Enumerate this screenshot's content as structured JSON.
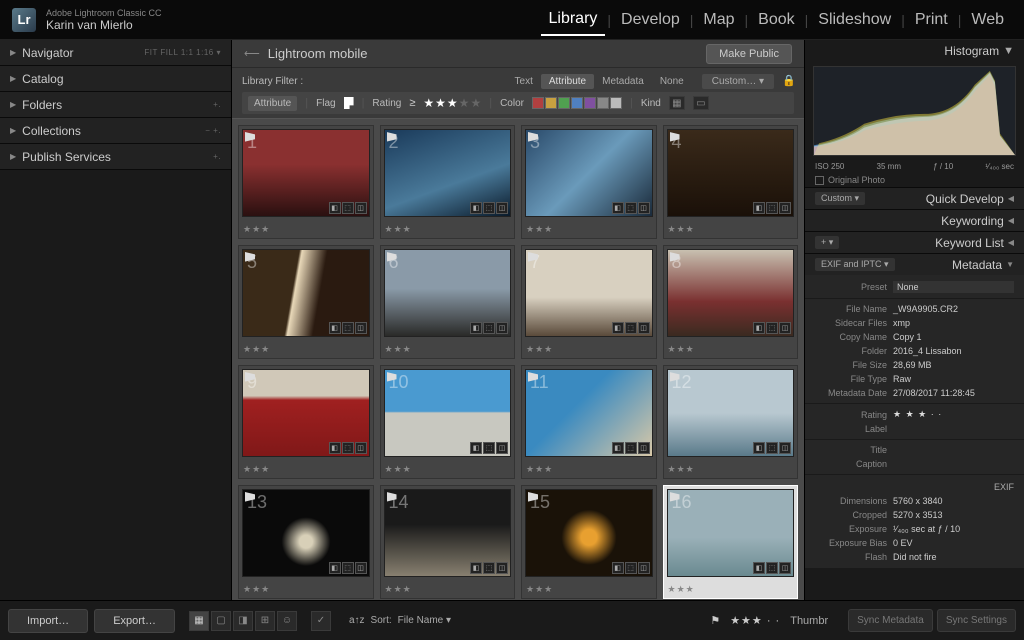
{
  "app": {
    "title": "Adobe Lightroom Classic CC",
    "user": "Karin van Mierlo",
    "logo": "Lr"
  },
  "modules": [
    "Library",
    "Develop",
    "Map",
    "Book",
    "Slideshow",
    "Print",
    "Web"
  ],
  "active_module": "Library",
  "left_panels": [
    {
      "title": "Navigator",
      "right": "FIT  FILL  1:1  1:16 ▾"
    },
    {
      "title": "Catalog",
      "right": ""
    },
    {
      "title": "Folders",
      "right": "+."
    },
    {
      "title": "Collections",
      "right": "−  +."
    },
    {
      "title": "Publish Services",
      "right": "+."
    }
  ],
  "center": {
    "collection_title": "Lightroom mobile",
    "make_public": "Make Public",
    "filter_label": "Library Filter :",
    "filter_tabs": [
      "Text",
      "Attribute",
      "Metadata",
      "None"
    ],
    "filter_active": "Attribute",
    "custom": "Custom…",
    "row2": {
      "attribute": "Attribute",
      "flag": "Flag",
      "rating": "Rating",
      "ge": "≥",
      "color": "Color",
      "kind": "Kind"
    },
    "color_swatches": [
      "#b04040",
      "#c8a040",
      "#50a050",
      "#5080c0",
      "#8050a0",
      "#888888",
      "#bbbbbb"
    ],
    "thumbs": [
      {
        "n": "1",
        "bg": "linear-gradient(180deg,#8a3030 40%,#2a1010)",
        "sel": false
      },
      {
        "n": "2",
        "bg": "linear-gradient(160deg,#1a3a5a,#4a7a9a 60%,#0a1a2a)",
        "sel": false
      },
      {
        "n": "3",
        "bg": "linear-gradient(135deg,#2a4a6a,#6a9aba 50%,#1a2a3a)",
        "sel": false
      },
      {
        "n": "4",
        "bg": "linear-gradient(180deg,#3a2a1a,#1a1008)",
        "sel": false
      },
      {
        "n": "5",
        "bg": "linear-gradient(100deg,#3a2a18 40%,#e8d8b8 42%,#2a1a10 60%)",
        "sel": false
      },
      {
        "n": "6",
        "bg": "linear-gradient(180deg,#8a9aa8 45%,#2a2a28)",
        "sel": false
      },
      {
        "n": "7",
        "bg": "linear-gradient(180deg,#d8d0c0 55%,#5a4a3a)",
        "sel": false
      },
      {
        "n": "8",
        "bg": "linear-gradient(180deg,#c8c0b0,#7a3030 60%,#3a2a20)",
        "sel": false
      },
      {
        "n": "9",
        "bg": "linear-gradient(180deg,#d0c8b8 30%,#a02020 35%,#801818)",
        "sel": false
      },
      {
        "n": "10",
        "bg": "linear-gradient(180deg,#4a9ad0 48%,#c8c8c0 50%)",
        "sel": false
      },
      {
        "n": "11",
        "bg": "linear-gradient(135deg,#3a8ac0 40%,#d8c8a8)",
        "sel": false
      },
      {
        "n": "12",
        "bg": "linear-gradient(180deg,#b8c8d0 50%,#5a7a8a)",
        "sel": false
      },
      {
        "n": "13",
        "bg": "radial-gradient(circle at 50% 60%,#d8d0b8 8%,#0a0a0a 30%)",
        "sel": false
      },
      {
        "n": "14",
        "bg": "linear-gradient(180deg,#1a1a1a 40%,#888070)",
        "sel": false
      },
      {
        "n": "15",
        "bg": "radial-gradient(circle at 50% 55%,#e8a030 10%,#1a1208 35%)",
        "sel": false
      },
      {
        "n": "16",
        "bg": "linear-gradient(180deg,#9ab0b8 55%,#6a8a90)",
        "sel": true
      }
    ]
  },
  "histogram": {
    "title": "Histogram",
    "info": [
      "ISO 250",
      "35 mm",
      "ƒ / 10",
      "¹⁄₄₀₀ sec"
    ],
    "original": "Original Photo"
  },
  "right_panels": [
    {
      "dd": "Custom",
      "title": "Quick Develop",
      "tri": "◀"
    },
    {
      "dd": "",
      "title": "Keywording",
      "tri": "◀"
    },
    {
      "dd": "+",
      "title": "Keyword List",
      "tri": "◀"
    },
    {
      "dd": "EXIF and IPTC",
      "title": "Metadata",
      "tri": "▼"
    }
  ],
  "metadata": {
    "preset_label": "Preset",
    "preset_val": "None",
    "rows": [
      {
        "l": "File Name",
        "v": "_W9A9905.CR2"
      },
      {
        "l": "Sidecar Files",
        "v": "xmp"
      },
      {
        "l": "Copy Name",
        "v": "Copy 1"
      },
      {
        "l": "Folder",
        "v": "2016_4 Lissabon"
      },
      {
        "l": "File Size",
        "v": "28,69 MB"
      },
      {
        "l": "File Type",
        "v": "Raw"
      },
      {
        "l": "Metadata Date",
        "v": "27/08/2017 11:28:45"
      }
    ],
    "rating_label": "Rating",
    "rating_val": "★ ★ ★ · ·",
    "label_label": "Label",
    "label_val": "",
    "title_label": "Title",
    "title_val": "",
    "caption_label": "Caption",
    "caption_val": "",
    "exif_title": "EXIF",
    "exif_rows": [
      {
        "l": "Dimensions",
        "v": "5760 x 3840"
      },
      {
        "l": "Cropped",
        "v": "5270 x 3513"
      },
      {
        "l": "Exposure",
        "v": "¹⁄₄₀₀ sec at ƒ / 10"
      },
      {
        "l": "Exposure Bias",
        "v": "0 EV"
      },
      {
        "l": "Flash",
        "v": "Did not fire"
      }
    ]
  },
  "bottom": {
    "import": "Import…",
    "export": "Export…",
    "sort_label": "Sort:",
    "sort_val": "File Name",
    "thumb_label": "Thumbr",
    "sync_meta": "Sync Metadata",
    "sync_settings": "Sync Settings"
  }
}
